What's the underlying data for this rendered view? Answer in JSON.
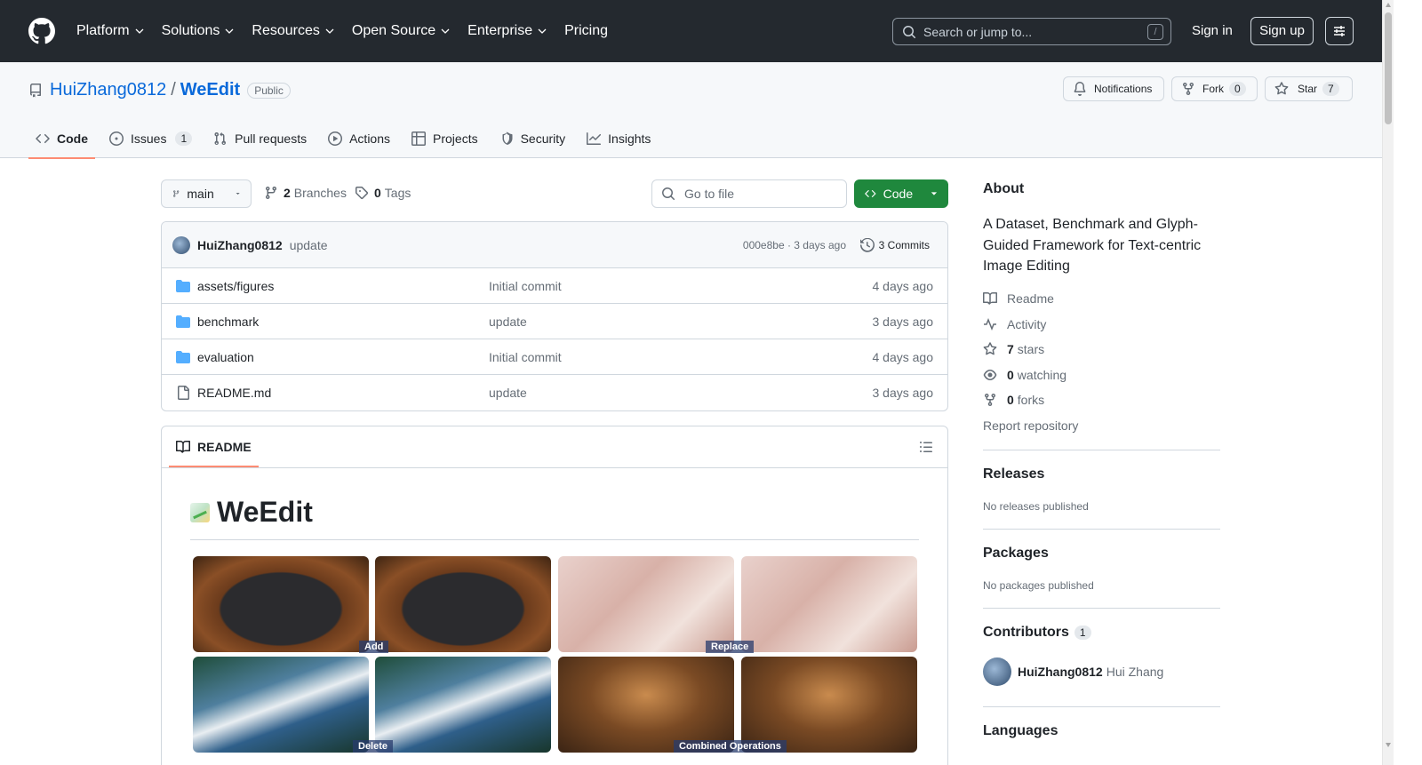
{
  "header": {
    "nav": [
      "Platform",
      "Solutions",
      "Resources",
      "Open Source",
      "Enterprise",
      "Pricing"
    ],
    "nav_has_chevron": [
      true,
      true,
      true,
      true,
      true,
      false
    ],
    "search_placeholder": "Search or jump to...",
    "search_shortcut": "/",
    "signin": "Sign in",
    "signup": "Sign up"
  },
  "repo": {
    "owner": "HuiZhang0812",
    "separator": "/",
    "name": "WeEdit",
    "visibility": "Public",
    "notifications_label": "Notifications",
    "fork_label": "Fork",
    "fork_count": "0",
    "star_label": "Star",
    "star_count": "7"
  },
  "tabs": [
    {
      "label": "Code",
      "count": null,
      "icon": "code-icon"
    },
    {
      "label": "Issues",
      "count": "1",
      "icon": "issue-icon"
    },
    {
      "label": "Pull requests",
      "count": null,
      "icon": "pull-request-icon"
    },
    {
      "label": "Actions",
      "count": null,
      "icon": "play-icon"
    },
    {
      "label": "Projects",
      "count": null,
      "icon": "table-icon"
    },
    {
      "label": "Security",
      "count": null,
      "icon": "shield-icon"
    },
    {
      "label": "Insights",
      "count": null,
      "icon": "graph-icon"
    }
  ],
  "toolbar": {
    "branch": "main",
    "branches_count": "2",
    "branches_label": "Branches",
    "tags_count": "0",
    "tags_label": "Tags",
    "goto_placeholder": "Go to file",
    "code_button": "Code"
  },
  "latest_commit": {
    "author": "HuiZhang0812",
    "message": "update",
    "meta": "000e8be · 3 days ago",
    "commits": "3 Commits"
  },
  "files": [
    {
      "name": "assets/figures",
      "type": "dir",
      "commit": "Initial commit",
      "age": "4 days ago"
    },
    {
      "name": "benchmark",
      "type": "dir",
      "commit": "update",
      "age": "3 days ago"
    },
    {
      "name": "evaluation",
      "type": "dir",
      "commit": "Initial commit",
      "age": "4 days ago"
    },
    {
      "name": "README.md",
      "type": "file",
      "commit": "update",
      "age": "3 days ago"
    }
  ],
  "readme": {
    "tab_label": "README",
    "title": "WeEdit",
    "captions": [
      "Add",
      "Replace",
      "Delete",
      "Combined Operations"
    ]
  },
  "sidebar": {
    "about_title": "About",
    "description": "A Dataset, Benchmark and Glyph-Guided Framework for Text-centric Image Editing",
    "readme": "Readme",
    "activity": "Activity",
    "stars_count": "7",
    "stars_label": "stars",
    "watching_count": "0",
    "watching_label": "watching",
    "forks_count": "0",
    "forks_label": "forks",
    "report": "Report repository",
    "releases_title": "Releases",
    "releases_note": "No releases published",
    "packages_title": "Packages",
    "packages_note": "No packages published",
    "contributors_title": "Contributors",
    "contributors_count": "1",
    "contributor_login": "HuiZhang0812",
    "contributor_name": "Hui Zhang",
    "languages_title": "Languages"
  },
  "colors": {
    "header_bg": "#24292f",
    "link": "#0969da",
    "primary_button": "#1f883d",
    "tab_underline": "#fd8c73",
    "folder": "#54aeff"
  }
}
